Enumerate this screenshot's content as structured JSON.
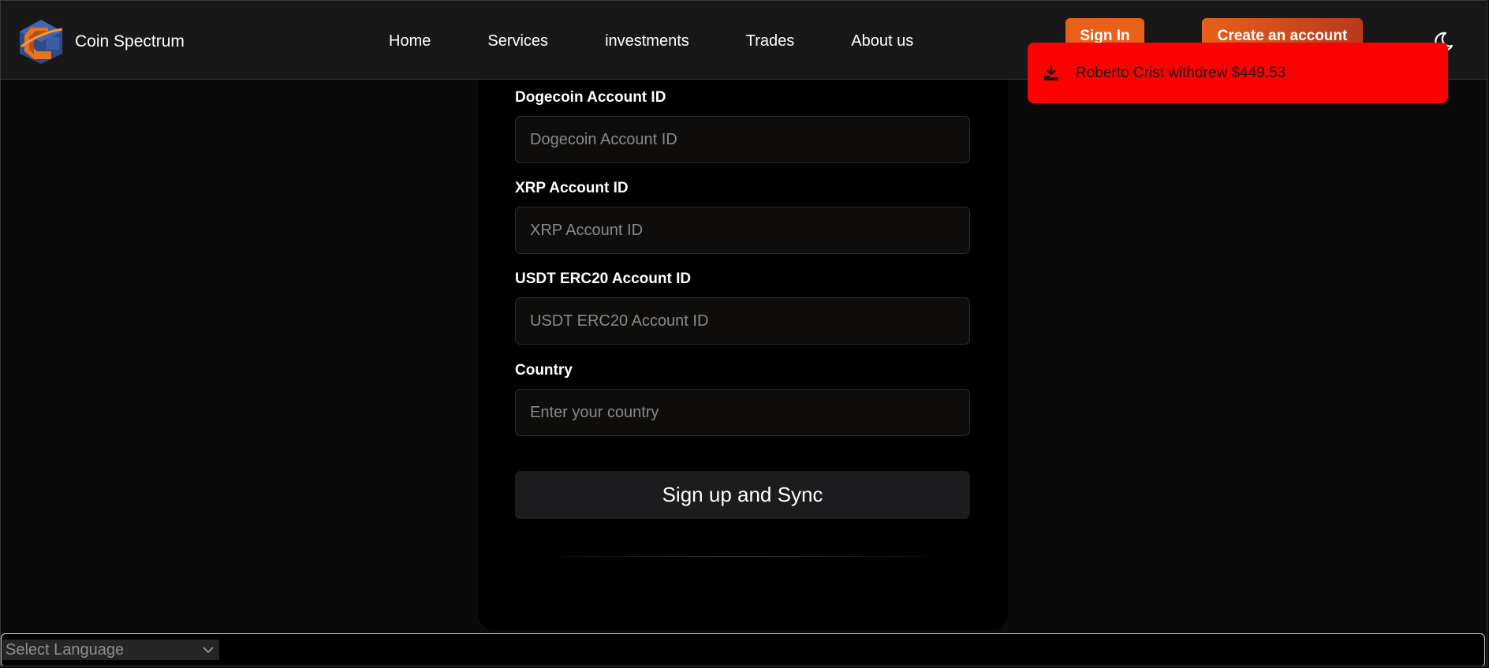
{
  "brand": {
    "name": "Coin Spectrum",
    "logo_icon": "coin-spectrum-logo"
  },
  "nav": [
    "Home",
    "Services",
    "investments",
    "Trades",
    "About us"
  ],
  "header": {
    "signin_label": "Sign In",
    "create_label": "Create an account",
    "theme_icon": "moon-icon"
  },
  "toast": {
    "text": "Roberto Crist withdrew $449.53",
    "icon": "withdraw-icon",
    "color": "#fd0100"
  },
  "form": {
    "fields": [
      {
        "label": "Dogecoin Account ID",
        "placeholder": "Dogecoin Account ID"
      },
      {
        "label": "XRP Account ID",
        "placeholder": "XRP Account ID"
      },
      {
        "label": "USDT ERC20 Account ID",
        "placeholder": "USDT ERC20 Account ID"
      },
      {
        "label": "Country",
        "placeholder": "Enter your country"
      }
    ],
    "submit_label": "Sign up and Sync"
  },
  "language": {
    "selected": "Select Language"
  },
  "colors": {
    "accent": "#e8601a",
    "background": "#0a0a0a",
    "card": "#000000"
  }
}
